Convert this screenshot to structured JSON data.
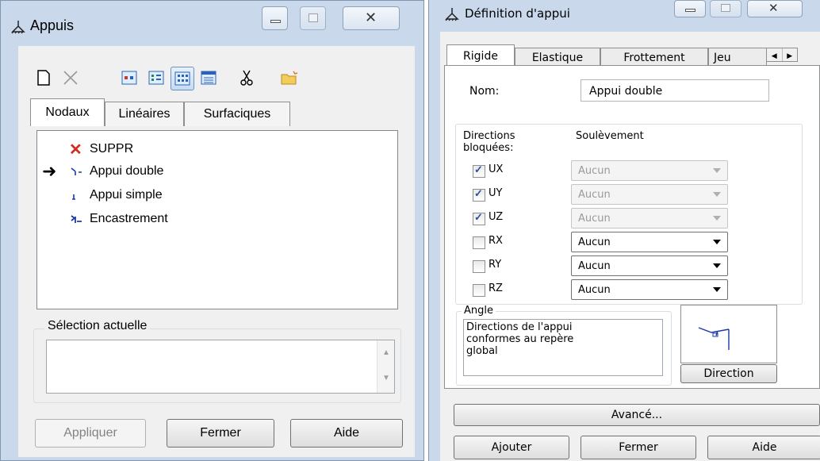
{
  "appuis_window": {
    "title": "Appuis",
    "tabs": [
      "Nodaux",
      "Linéaires",
      "Surfaciques"
    ],
    "list_items": [
      "SUPPR",
      "Appui double",
      "Appui simple",
      "Encastrement"
    ],
    "current_selection_label": "Sélection actuelle",
    "current_selection_value": "",
    "buttons": {
      "apply": "Appliquer",
      "close": "Fermer",
      "help": "Aide"
    },
    "toolbar_icons": [
      "new-icon",
      "delete-icon",
      "view-icon-1",
      "view-icon-2",
      "view-icon-3",
      "view-icon-4",
      "scissors-icon",
      "folder-icon"
    ]
  },
  "definition_window": {
    "title": "Définition d'appui",
    "tabs": [
      "Rigide",
      "Elastique",
      "Frottement",
      "Jeu"
    ],
    "name_label": "Nom:",
    "name_value": "Appui double",
    "blocked_dirs_label": "Directions\nbloquées:",
    "uplift_label": "Soulèvement",
    "directions": [
      {
        "label": "UX",
        "checked": true,
        "value": "Aucun",
        "enabled": false
      },
      {
        "label": "UY",
        "checked": true,
        "value": "Aucun",
        "enabled": false
      },
      {
        "label": "UZ",
        "checked": true,
        "value": "Aucun",
        "enabled": false
      },
      {
        "label": "RX",
        "checked": false,
        "value": "Aucun",
        "enabled": true
      },
      {
        "label": "RY",
        "checked": false,
        "value": "Aucun",
        "enabled": true
      },
      {
        "label": "RZ",
        "checked": false,
        "value": "Aucun",
        "enabled": true
      }
    ],
    "angle_label": "Angle",
    "angle_text": "Directions de l'appui\nconformes au repère\nglobal",
    "direction_button": "Direction",
    "advanced_button": "Avancé...",
    "buttons": {
      "add": "Ajouter",
      "close": "Fermer",
      "help": "Aide"
    }
  },
  "colors": {
    "frame": "#c9d9eb",
    "dialog_bg": "#f0f0f0",
    "suppr_x": "#d42a1f",
    "icon_blue": "#1b3aa6"
  }
}
